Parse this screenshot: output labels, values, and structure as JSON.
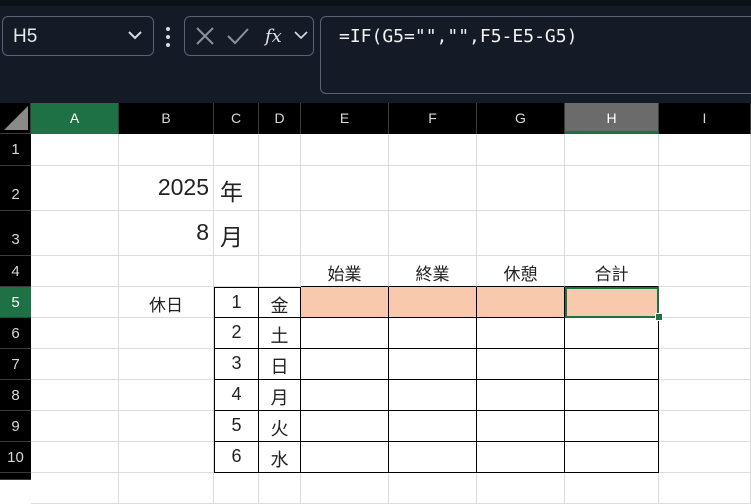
{
  "name_box": {
    "value": "H5"
  },
  "formula_bar": {
    "formula": "=IF(G5=\"\",\"\",F5-E5-G5)"
  },
  "columns": [
    "A",
    "B",
    "C",
    "D",
    "E",
    "F",
    "G",
    "H",
    "I"
  ],
  "rows": [
    "1",
    "2",
    "3",
    "4",
    "5",
    "6",
    "7",
    "8",
    "9",
    "10"
  ],
  "sheet": {
    "year_value": "2025",
    "year_unit": "年",
    "month_value": "8",
    "month_unit": "月",
    "headers": {
      "start": "始業",
      "end": "終業",
      "break": "休憩",
      "total": "合計"
    },
    "holiday_label": "休日",
    "days": [
      {
        "date": "1",
        "weekday": "金"
      },
      {
        "date": "2",
        "weekday": "土"
      },
      {
        "date": "3",
        "weekday": "日"
      },
      {
        "date": "4",
        "weekday": "月"
      },
      {
        "date": "5",
        "weekday": "火"
      },
      {
        "date": "6",
        "weekday": "水"
      }
    ]
  },
  "selection": {
    "active_cell": "H5"
  },
  "colors": {
    "accent": "#1e7145",
    "highlight_fill": "#f8c9ad",
    "topbar_bg": "#141a26"
  },
  "icons": [
    "chevron-down-icon",
    "more-options-icon",
    "cancel-icon",
    "enter-icon",
    "insert-function-icon",
    "select-all-icon",
    "fill-handle-icon"
  ]
}
